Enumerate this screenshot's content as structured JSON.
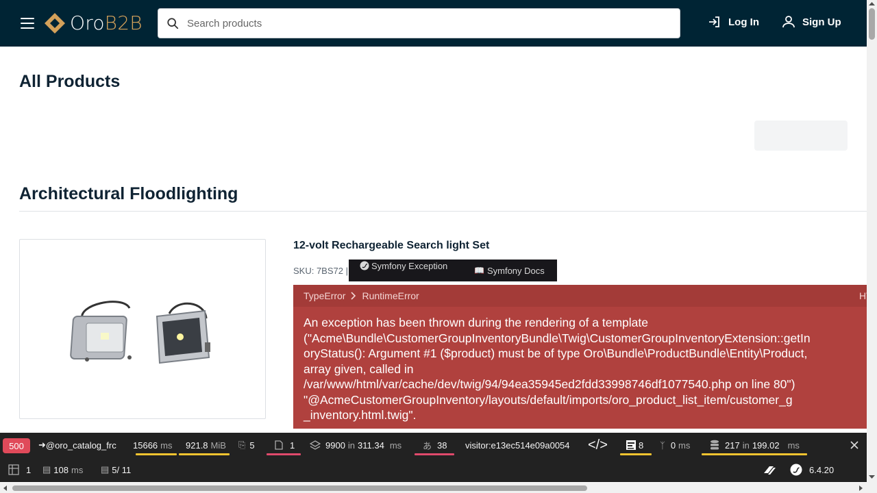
{
  "header": {
    "logo_prefix": "Oro",
    "logo_suffix": "B2B",
    "search_placeholder": "Search products",
    "login_label": "Log In",
    "signup_label": "Sign Up"
  },
  "main": {
    "page_title": "All Products",
    "category_title": "Architectural Floodlighting",
    "product": {
      "title": "12-volt Rechargeable Search light Set",
      "sku": "SKU: 7BS72 |"
    }
  },
  "symfony_tabs": {
    "exception_label": "Symfony Exception",
    "docs_label": "Symfony Docs"
  },
  "error": {
    "breadcrumb_1": "TypeError",
    "breadcrumb_2": "RuntimeError",
    "breadcrumb_right": "HT",
    "message": "An exception has been thrown during the rendering of a template\n(\"Acme\\Bundle\\CustomerGroupInventoryBundle\\Twig\\CustomerGroupInventoryExtension::getIn\noryStatus(): Argument #1 ($product) must be of type Oro\\Bundle\\ProductBundle\\Entity\\Product,\narray given, called in\n/var/www/html/var/cache/dev/twig/94/94ea35945ed2fdd33998746df1077540.php on line 80\")\n\"@AcmeCustomerGroupInventory/layouts/default/imports/oro_product_list_item/customer_g\n_inventory.html.twig\"."
  },
  "toolbar": {
    "status_code": "500",
    "route": "@oro_catalog_frc",
    "time": "15666",
    "time_unit": "ms",
    "memory": "921.8",
    "memory_unit": "MiB",
    "forms": "5",
    "logs": "1",
    "events_count": "9900",
    "events_in": "in",
    "events_time": "311.34",
    "events_unit": "ms",
    "translations": "38",
    "user": "visitor:e13ec514e09a0054",
    "twig_count": "8",
    "cache_time": "0",
    "cache_unit": "ms",
    "db_queries": "217",
    "db_in": "in",
    "db_time": "199.02",
    "db_unit": "ms",
    "row2_tables": "1",
    "row2_time": "108",
    "row2_time_unit": "ms",
    "row2_pages": "5/ 11",
    "symfony_version": "6.4.20"
  },
  "colors": {
    "header_bg": "#002434",
    "logo_accent": "#d4a15a",
    "error_bg": "#b0413e",
    "toolbar_bg": "#222222",
    "status_red": "#e04a5a",
    "bar_yellow": "#f4c430"
  }
}
